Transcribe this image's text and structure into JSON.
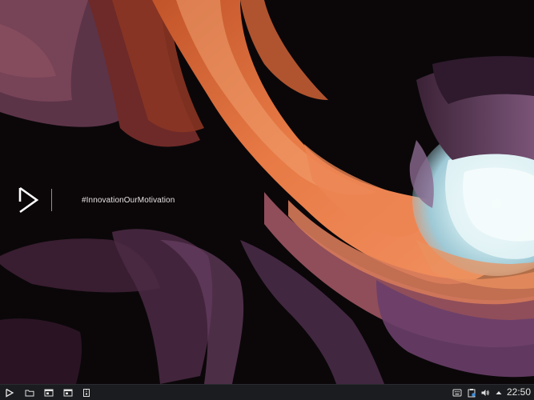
{
  "desktop": {
    "wallpaper_icon": "canyon-wallpaper",
    "brand": {
      "logo_icon": "play-triangle-logo-icon",
      "tagline": "#InnovationOurMotivation"
    }
  },
  "taskbar": {
    "launcher_icon": "play-triangle-icon",
    "apps": [
      {
        "icon": "folder-icon"
      },
      {
        "icon": "window-icon"
      },
      {
        "icon": "window-icon"
      },
      {
        "icon": "archive-icon"
      }
    ],
    "tray": [
      {
        "icon": "keyboard-icon"
      },
      {
        "icon": "clipboard-icon"
      },
      {
        "icon": "volume-icon"
      },
      {
        "icon": "chevron-up-icon"
      }
    ],
    "clock": "22:50"
  },
  "colors": {
    "taskbar_bg": "#1b1c1f",
    "accent_orange": "#e66a2e",
    "canyon_purple": "#5a3458",
    "light_opening": "#e8f6f8"
  }
}
